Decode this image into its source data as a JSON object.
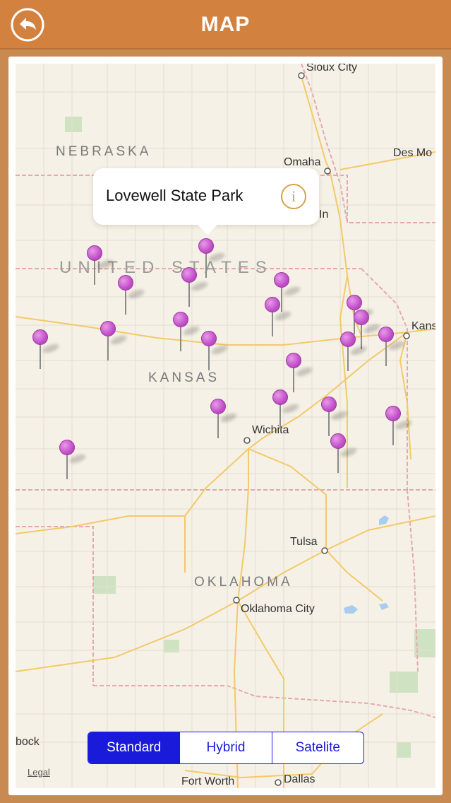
{
  "header": {
    "title": "MAP",
    "back_icon": "back-arrow-icon"
  },
  "map": {
    "cities": [
      {
        "id": "sioux-city",
        "label": "Sioux City"
      },
      {
        "id": "omaha",
        "label": "Omaha"
      },
      {
        "id": "lincoln-partial",
        "label": "In"
      },
      {
        "id": "des-moines-partial",
        "label": "Des Mo"
      },
      {
        "id": "kansas-city-partial",
        "label": "Kans"
      },
      {
        "id": "wichita",
        "label": "Wichita"
      },
      {
        "id": "tulsa",
        "label": "Tulsa"
      },
      {
        "id": "oklahoma-city",
        "label": "Oklahoma City"
      },
      {
        "id": "fort-worth",
        "label": "Fort Worth"
      },
      {
        "id": "dallas",
        "label": "Dallas"
      },
      {
        "id": "lubbock-partial",
        "label": "bock"
      }
    ],
    "states": {
      "nebraska": "NEBRASKA",
      "kansas": "KANSAS",
      "oklahoma": "OKLAHOMA"
    },
    "country": "UNITED STATES",
    "legal": "Legal",
    "pin_color": "#c24fc9",
    "pin_count": 21
  },
  "callout": {
    "title": "Lovewell State Park",
    "info_icon": "info-icon"
  },
  "map_type": {
    "options": [
      "Standard",
      "Hybrid",
      "Satelite"
    ],
    "selected": "Standard"
  }
}
